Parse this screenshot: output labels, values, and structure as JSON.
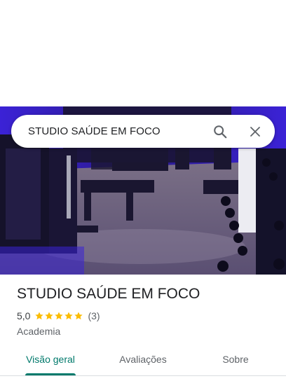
{
  "search": {
    "query": "STUDIO SAÚDE EM FOCO",
    "search_icon": "search-icon",
    "close_icon": "close-icon"
  },
  "photo": {
    "subject": "gym-interior-photo",
    "accent_color": "#3b22d6"
  },
  "place": {
    "name": "STUDIO SAÚDE EM FOCO",
    "rating": "5,0",
    "stars": 5,
    "reviews": "(3)",
    "category": "Academia",
    "star_color": "#fbbc04"
  },
  "tabs": [
    {
      "label": "Visão geral",
      "active": true
    },
    {
      "label": "Avaliações",
      "active": false
    },
    {
      "label": "Sobre",
      "active": false
    }
  ],
  "colors": {
    "tab_active": "#00796b",
    "divider": "#dadce0"
  }
}
